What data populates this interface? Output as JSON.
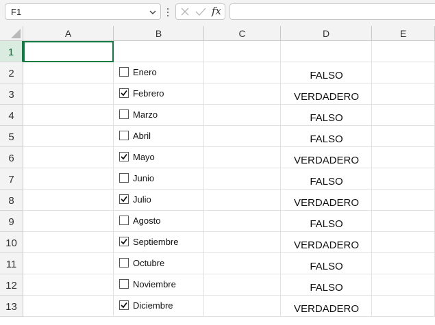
{
  "formula_bar": {
    "name_box": "F1",
    "formula": "",
    "fx_label": "fx",
    "icons": [
      "chevron-down-icon",
      "more-vertical-icon",
      "cancel-icon",
      "enter-icon"
    ]
  },
  "columns": [
    "A",
    "B",
    "C",
    "D",
    "E"
  ],
  "rows": [
    {
      "num": "1",
      "label": "",
      "checked": null,
      "result": ""
    },
    {
      "num": "2",
      "label": "Enero",
      "checked": false,
      "result": "FALSO"
    },
    {
      "num": "3",
      "label": "Febrero",
      "checked": true,
      "result": "VERDADERO"
    },
    {
      "num": "4",
      "label": "Marzo",
      "checked": false,
      "result": "FALSO"
    },
    {
      "num": "5",
      "label": "Abril",
      "checked": false,
      "result": "FALSO"
    },
    {
      "num": "6",
      "label": "Mayo",
      "checked": true,
      "result": "VERDADERO"
    },
    {
      "num": "7",
      "label": "Junio",
      "checked": false,
      "result": "FALSO"
    },
    {
      "num": "8",
      "label": "Julio",
      "checked": true,
      "result": "VERDADERO"
    },
    {
      "num": "9",
      "label": "Agosto",
      "checked": false,
      "result": "FALSO"
    },
    {
      "num": "10",
      "label": "Septiembre",
      "checked": true,
      "result": "VERDADERO"
    },
    {
      "num": "11",
      "label": "Octubre",
      "checked": false,
      "result": "FALSO"
    },
    {
      "num": "12",
      "label": "Noviembre",
      "checked": false,
      "result": "FALSO"
    },
    {
      "num": "13",
      "label": "Diciembre",
      "checked": true,
      "result": "VERDADERO"
    }
  ],
  "colors": {
    "accent": "#107c41",
    "header_bg": "#f3f3f3"
  }
}
